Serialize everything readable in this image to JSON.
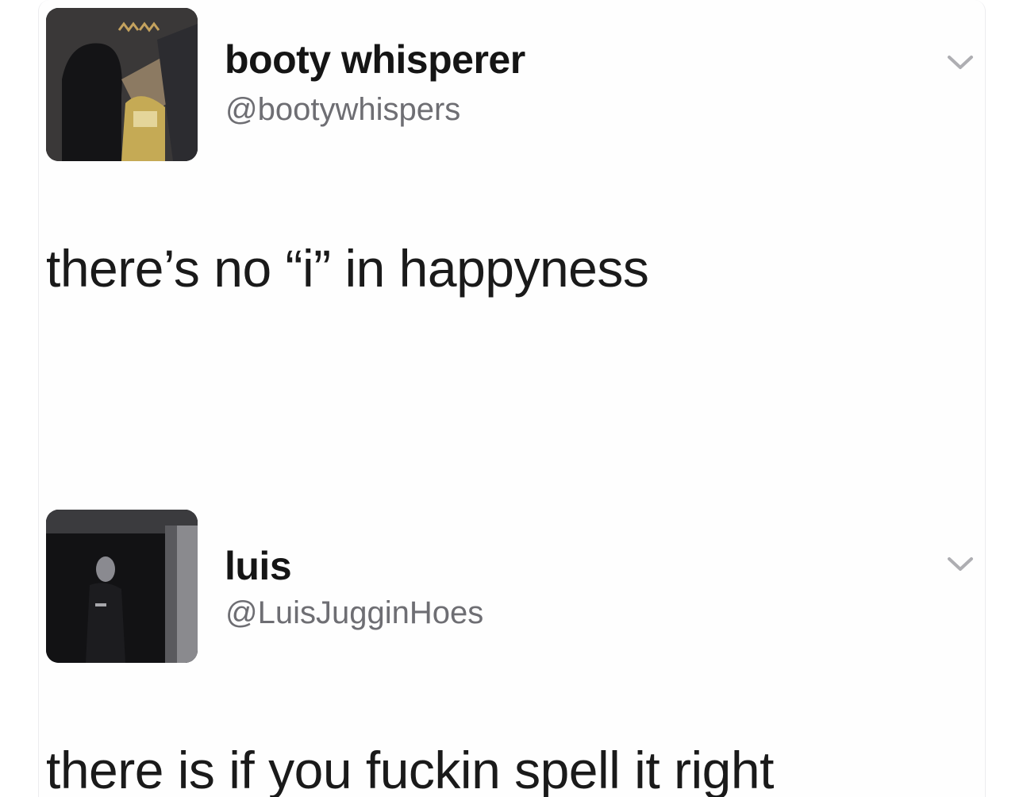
{
  "tweets": [
    {
      "display_name": "booty whisperer",
      "handle": "@bootywhispers",
      "text": "there’s no “i” in happyness",
      "menu_icon": "chevron-down-icon",
      "avatar_description_icon": "avatar"
    },
    {
      "display_name": "luis",
      "handle": "@LuisJugginHoes",
      "text": "there is if you fuckin spell it right",
      "menu_icon": "chevron-down-icon",
      "avatar_description_icon": "avatar"
    }
  ],
  "colors": {
    "name": "#151515",
    "handle": "#6e6e73",
    "body": "#1a1a1a",
    "chevron": "#aeaeb2",
    "background": "#ffffff"
  }
}
